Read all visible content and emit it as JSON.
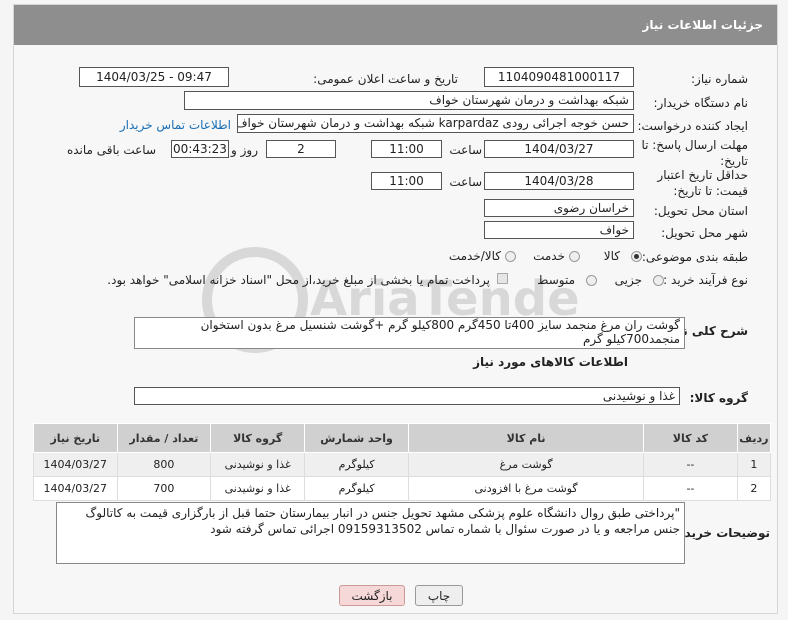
{
  "header": {
    "title": "جزئیات اطلاعات نیاز"
  },
  "fields": {
    "need_number_label": "شماره نیاز:",
    "need_number": "1104090481000117",
    "announce_label": "تاریخ و ساعت اعلان عمومی:",
    "announce_value": "1404/03/25 - 09:47",
    "buyer_org_label": "نام دستگاه خریدار:",
    "buyer_org": "شبکه بهداشت و درمان شهرستان خواف",
    "requester_label": "ایجاد کننده درخواست:",
    "requester": "حسن خوجه اجرائی رودی karpardaz شبکه بهداشت و درمان شهرستان خواف",
    "buyer_contact_link": "اطلاعات تماس خریدار",
    "deadline_label": "مهلت ارسال پاسخ: تا تاریخ:",
    "deadline_date": "1404/03/27",
    "time_label": "ساعت",
    "deadline_time": "11:00",
    "days_value": "2",
    "days_label": "روز و",
    "remaining_time": "00:43:23",
    "remaining_label": "ساعت باقی مانده",
    "min_validity_label": "حداقل تاریخ اعتبار قیمت: تا تاریخ:",
    "validity_date": "1404/03/28",
    "validity_time": "11:00",
    "province_label": "استان محل تحویل:",
    "province": "خراسان رضوی",
    "city_label": "شهر محل تحویل:",
    "city": "خواف",
    "category_label": "طبقه بندی موضوعی:",
    "category_options": [
      "کالا",
      "خدمت",
      "کالا/خدمت"
    ],
    "process_label": "نوع فرآیند خرید :",
    "process_options": [
      "جزیی",
      "متوسط"
    ],
    "payment_note": "پرداخت تمام یا بخشی از مبلغ خرید،از محل \"اسناد خزانه اسلامی\" خواهد بود.",
    "summary_label": "شرح کلی نیاز:",
    "summary": "گوشت ران مرغ منجمد سایز 400تا 450گرم 800کیلو گرم +گوشت شنسیل مرغ بدون استخوان منجمد700کیلو گرم",
    "goods_info_title": "اطلاعات کالاهای مورد نیاز",
    "goods_group_label": "گروه کالا:",
    "goods_group": "غذا و نوشیدنی",
    "buyer_notes_label": "توضیحات خریدار:",
    "buyer_notes": "\"پرداختی طبق روال دانشگاه علوم پزشکی مشهد تحویل جنس در انبار بیمارستان  حتما قبل از بارگزاری قیمت به کاتالوگ جنس مراجعه و یا در صورت سئوال با  شماره تماس 09159313502 اجرائی تماس گرفته شود"
  },
  "table": {
    "headers": [
      "ردیف",
      "کد کالا",
      "نام کالا",
      "واحد شمارش",
      "گروه کالا",
      "تعداد / مقدار",
      "تاریخ نیاز"
    ],
    "rows": [
      [
        "1",
        "--",
        "گوشت مرغ",
        "کیلوگرم",
        "غذا و نوشیدنی",
        "800",
        "1404/03/27"
      ],
      [
        "2",
        "--",
        "گوشت مرغ با افزودنی",
        "کیلوگرم",
        "غذا و نوشیدنی",
        "700",
        "1404/03/27"
      ]
    ]
  },
  "buttons": {
    "print": "چاپ",
    "back": "بازگشت"
  },
  "watermark": {
    "text": "AriaTender.net"
  }
}
